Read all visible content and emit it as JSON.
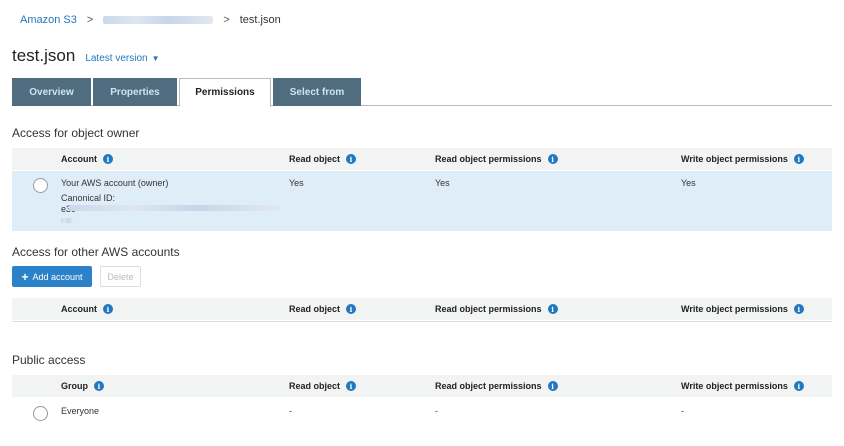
{
  "breadcrumb": {
    "root": "Amazon S3",
    "separator": ">",
    "current": "test.json"
  },
  "header": {
    "title": "test.json",
    "version_label": "Latest version",
    "caret": "▼"
  },
  "tabs": [
    {
      "label": "Overview"
    },
    {
      "label": "Properties"
    },
    {
      "label": "Permissions"
    },
    {
      "label": "Select from"
    }
  ],
  "owner_section": {
    "heading": "Access for object owner",
    "columns": [
      "Account",
      "Read object",
      "Read object permissions",
      "Write object permissions"
    ],
    "row": {
      "account": "Your AWS account (owner)",
      "canonical_label": "Canonical ID:",
      "canonical_prefix": "e39",
      "read_object": "Yes",
      "read_perms": "Yes",
      "write_perms": "Yes"
    }
  },
  "other_section": {
    "heading": "Access for other AWS accounts",
    "add_button": "Add account",
    "add_icon": "+",
    "delete_button": "Delete",
    "columns": [
      "Account",
      "Read object",
      "Read object permissions",
      "Write object permissions"
    ]
  },
  "public_section": {
    "heading": "Public access",
    "columns": [
      "Group",
      "Read object",
      "Read object permissions",
      "Write object permissions"
    ],
    "row": {
      "group": "Everyone",
      "read_object": "-",
      "read_perms": "-",
      "write_perms": "-"
    }
  },
  "icons": {
    "info": "i"
  },
  "colors": {
    "accent": "#2278bf",
    "tab_bg": "#506d7f",
    "selected_row": "#deedf8",
    "primary_button": "#2c82c9"
  }
}
